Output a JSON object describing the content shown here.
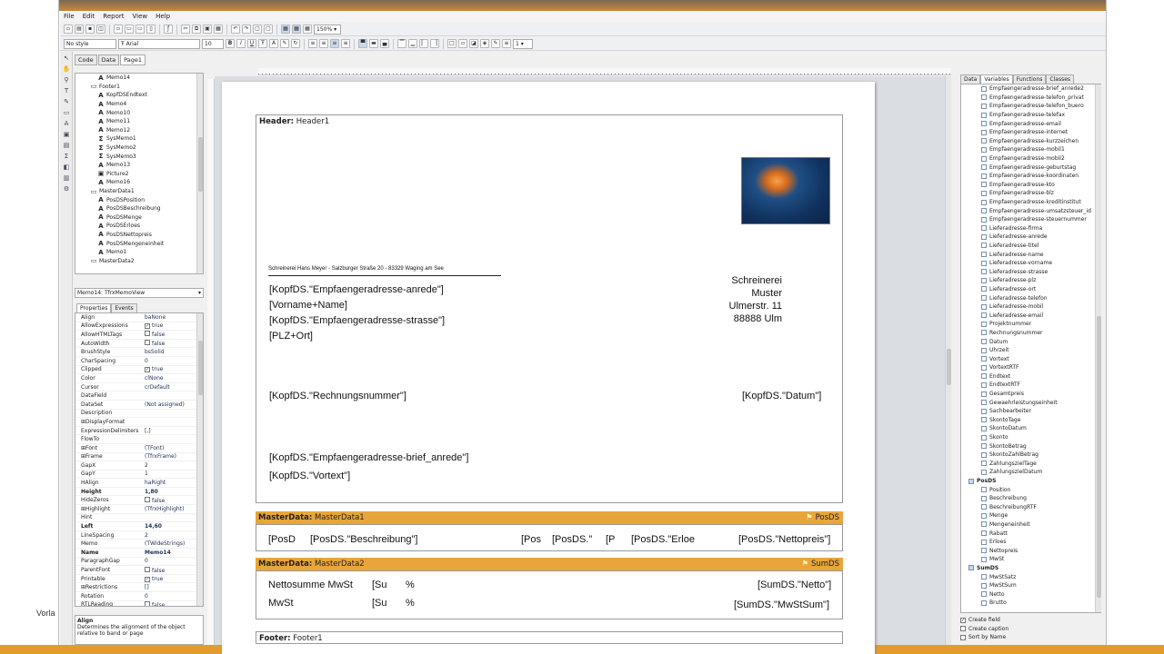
{
  "menu": [
    "File",
    "Edit",
    "Report",
    "View",
    "Help"
  ],
  "toolbar": {
    "zoom": "150%",
    "style": "No style",
    "font": "Arial",
    "size": "10",
    "bold": "B",
    "italic": "I",
    "underline": "U",
    "frame_width": "1"
  },
  "page_tabs": [
    "Code",
    "Data",
    "Page1"
  ],
  "tree": [
    {
      "i": "A",
      "t": "Memo14",
      "d": 3
    },
    {
      "i": "▭",
      "t": "Footer1",
      "d": 2
    },
    {
      "i": "A",
      "t": "KopfDSEndtext",
      "d": 3
    },
    {
      "i": "A",
      "t": "Memo4",
      "d": 3
    },
    {
      "i": "A",
      "t": "Memo10",
      "d": 3
    },
    {
      "i": "A",
      "t": "Memo11",
      "d": 3
    },
    {
      "i": "A",
      "t": "Memo12",
      "d": 3
    },
    {
      "i": "Σ",
      "t": "SysMemo1",
      "d": 3
    },
    {
      "i": "Σ",
      "t": "SysMemo2",
      "d": 3
    },
    {
      "i": "Σ",
      "t": "SysMemo3",
      "d": 3
    },
    {
      "i": "A",
      "t": "Memo13",
      "d": 3
    },
    {
      "i": "▣",
      "t": "Picture2",
      "d": 3
    },
    {
      "i": "A",
      "t": "Memo16",
      "d": 3
    },
    {
      "i": "▭",
      "t": "MasterData1",
      "d": 2
    },
    {
      "i": "A",
      "t": "PosDSPosition",
      "d": 3
    },
    {
      "i": "A",
      "t": "PosDSBeschreibung",
      "d": 3
    },
    {
      "i": "A",
      "t": "PosDSMenge",
      "d": 3
    },
    {
      "i": "A",
      "t": "PosDSErloes",
      "d": 3
    },
    {
      "i": "A",
      "t": "PosDSNettopreis",
      "d": 3
    },
    {
      "i": "A",
      "t": "PosDSMengeneinheit",
      "d": 3
    },
    {
      "i": "A",
      "t": "Memo1",
      "d": 3
    },
    {
      "i": "▭",
      "t": "MasterData2",
      "d": 2
    }
  ],
  "object_selector": "Memo14: TfrxMemoView",
  "inspector_tabs": [
    "Properties",
    "Events"
  ],
  "properties": [
    {
      "n": "Align",
      "v": "baNone"
    },
    {
      "n": "AllowExpressions",
      "v": "true",
      "cb": true
    },
    {
      "n": "AllowHTMLTags",
      "v": "false",
      "cb": false
    },
    {
      "n": "AutoWidth",
      "v": "false",
      "cb": false
    },
    {
      "n": "BrushStyle",
      "v": "bsSolid"
    },
    {
      "n": "CharSpacing",
      "v": "0"
    },
    {
      "n": "Clipped",
      "v": "true",
      "cb": true
    },
    {
      "n": "Color",
      "v": "clNone"
    },
    {
      "n": "Cursor",
      "v": "crDefault"
    },
    {
      "n": "DataField",
      "v": ""
    },
    {
      "n": "DataSet",
      "v": "(Not assigned)"
    },
    {
      "n": "Description",
      "v": ""
    },
    {
      "n": "⊞DisplayFormat",
      "v": ""
    },
    {
      "n": "ExpressionDelimiters",
      "v": "[,]"
    },
    {
      "n": "FlowTo",
      "v": ""
    },
    {
      "n": "⊞Font",
      "v": "(TFont)"
    },
    {
      "n": "⊞Frame",
      "v": "(TfrxFrame)"
    },
    {
      "n": "GapX",
      "v": "2"
    },
    {
      "n": "GapY",
      "v": "1"
    },
    {
      "n": "HAlign",
      "v": "haRight"
    },
    {
      "n": "Height",
      "v": "1,80",
      "b": true
    },
    {
      "n": "HideZeros",
      "v": "false",
      "cb": false
    },
    {
      "n": "⊞Highlight",
      "v": "(TfrxHighlight)"
    },
    {
      "n": "Hint",
      "v": ""
    },
    {
      "n": "Left",
      "v": "14,60",
      "b": true
    },
    {
      "n": "LineSpacing",
      "v": "2"
    },
    {
      "n": "Memo",
      "v": "(TWideStrings)"
    },
    {
      "n": "Name",
      "v": "Memo14",
      "b": true
    },
    {
      "n": "ParagraphGap",
      "v": "0"
    },
    {
      "n": "ParentFont",
      "v": "false",
      "cb": false
    },
    {
      "n": "Printable",
      "v": "true",
      "cb": true
    },
    {
      "n": "⊞Restrictions",
      "v": "[]"
    },
    {
      "n": "Rotation",
      "v": "0"
    },
    {
      "n": "RTLReading",
      "v": "false",
      "cb": false
    }
  ],
  "help": {
    "title": "Align",
    "text": "Determines the alignment of the object relative to band or page"
  },
  "report": {
    "header_label": "Header:",
    "header_name": "Header1",
    "sender_line": "Schreinerei Hans Meyer - Salzburger Straße 20 - 83329 Waging am See",
    "address_lines": [
      "[KopfDS.\"Empfaengeradresse-anrede\"]",
      "[Vorname+Name]",
      "[KopfDS.\"Empfaengeradresse-strasse\"]",
      "[PLZ+Ort]"
    ],
    "company_lines": [
      "Schreinerei",
      "Muster",
      "Ulmerstr. 11",
      "88888 Ulm"
    ],
    "invoice_no": "[KopfDS.\"Rechnungsnummer\"]",
    "date": "[KopfDS.\"Datum\"]",
    "salutation": "[KopfDS.\"Empfaengeradresse-brief_anrede\"]",
    "pretext": "[KopfDS.\"Vortext\"]",
    "md1_label": "MasterData:",
    "md1_name": "MasterData1",
    "md1_ds": "PosDS",
    "md1_fields": [
      "[PosD",
      "[PosDS.\"Beschreibung\"]",
      "[Pos",
      "[PosDS.\"",
      "[P",
      "[PosDS.\"Erloe",
      "[PosDS.\"Nettopreis\"]"
    ],
    "md2_label": "MasterData:",
    "md2_name": "MasterData2",
    "md2_ds": "SumDS",
    "md2_rows": [
      {
        "a": "Nettosumme MwSt",
        "b": "[Su",
        "c": "%",
        "d": "[SumDS.\"Netto\"]"
      },
      {
        "a": "MwSt",
        "b": "[Su",
        "c": "%",
        "d": "[SumDS.\"MwStSum\"]"
      }
    ],
    "footer_label": "Footer:",
    "footer_name": "Footer1"
  },
  "right_tabs": [
    "Data",
    "Variables",
    "Functions",
    "Classes"
  ],
  "variables": [
    {
      "t": "Empfaengeradresse-brief_anrede2"
    },
    {
      "t": "Empfaengeradresse-telefon_privat"
    },
    {
      "t": "Empfaengeradresse-telefon_buero"
    },
    {
      "t": "Empfaengeradresse-telefax"
    },
    {
      "t": "Empfaengeradresse-email"
    },
    {
      "t": "Empfaengeradresse-internet"
    },
    {
      "t": "Empfaengeradresse-kurzzeichen"
    },
    {
      "t": "Empfaengeradresse-mobil1"
    },
    {
      "t": "Empfaengeradresse-mobil2"
    },
    {
      "t": "Empfaengeradresse-geburtstag"
    },
    {
      "t": "Empfaengeradresse-koordinaten"
    },
    {
      "t": "Empfaengeradresse-kto"
    },
    {
      "t": "Empfaengeradresse-blz"
    },
    {
      "t": "Empfaengeradresse-kreditinstitut"
    },
    {
      "t": "Empfaengeradresse-umsatzsteuer_id"
    },
    {
      "t": "Empfaengeradresse-steuernummer"
    },
    {
      "t": "Lieferadresse-firma"
    },
    {
      "t": "Lieferadresse-anrede"
    },
    {
      "t": "Lieferadresse-titel"
    },
    {
      "t": "Lieferadresse-name"
    },
    {
      "t": "Lieferadresse-vorname"
    },
    {
      "t": "Lieferadresse-strasse"
    },
    {
      "t": "Lieferadresse-plz"
    },
    {
      "t": "Lieferadresse-ort"
    },
    {
      "t": "Lieferadresse-telefon"
    },
    {
      "t": "Lieferadresse-mobil"
    },
    {
      "t": "Lieferadresse-email"
    },
    {
      "t": "Projektnummer"
    },
    {
      "t": "Rechnungsnummer"
    },
    {
      "t": "Datum"
    },
    {
      "t": "Uhrzeit"
    },
    {
      "t": "Vortext"
    },
    {
      "t": "VortextRTF"
    },
    {
      "t": "Endtext"
    },
    {
      "t": "EndtextRTF"
    },
    {
      "t": "Gesamtpreis"
    },
    {
      "t": "Gewaehrleistungseinheit"
    },
    {
      "t": "Sachbearbeiter"
    },
    {
      "t": "SkontoTage"
    },
    {
      "t": "SkontoDatum"
    },
    {
      "t": "Skonto"
    },
    {
      "t": "SkontoBetrag"
    },
    {
      "t": "SkontoZahlBetrag"
    },
    {
      "t": "ZahlungszielTage"
    },
    {
      "t": "ZahlungszielDatum"
    },
    {
      "t": "PosDS",
      "g": true
    },
    {
      "t": "Position"
    },
    {
      "t": "Beschreibung"
    },
    {
      "t": "BeschreibungRTF"
    },
    {
      "t": "Menge"
    },
    {
      "t": "Mengeneinheit"
    },
    {
      "t": "Rabatt"
    },
    {
      "t": "Erloes"
    },
    {
      "t": "Nettopreis"
    },
    {
      "t": "MwSt"
    },
    {
      "t": "SumDS",
      "g": true
    },
    {
      "t": "MwStSatz"
    },
    {
      "t": "MwStSum"
    },
    {
      "t": "Netto"
    },
    {
      "t": "Brutto"
    }
  ],
  "options": [
    {
      "t": "Create field",
      "c": true
    },
    {
      "t": "Create caption",
      "c": false
    },
    {
      "t": "Sort by Name",
      "c": false
    }
  ],
  "side_text": "Vorla"
}
